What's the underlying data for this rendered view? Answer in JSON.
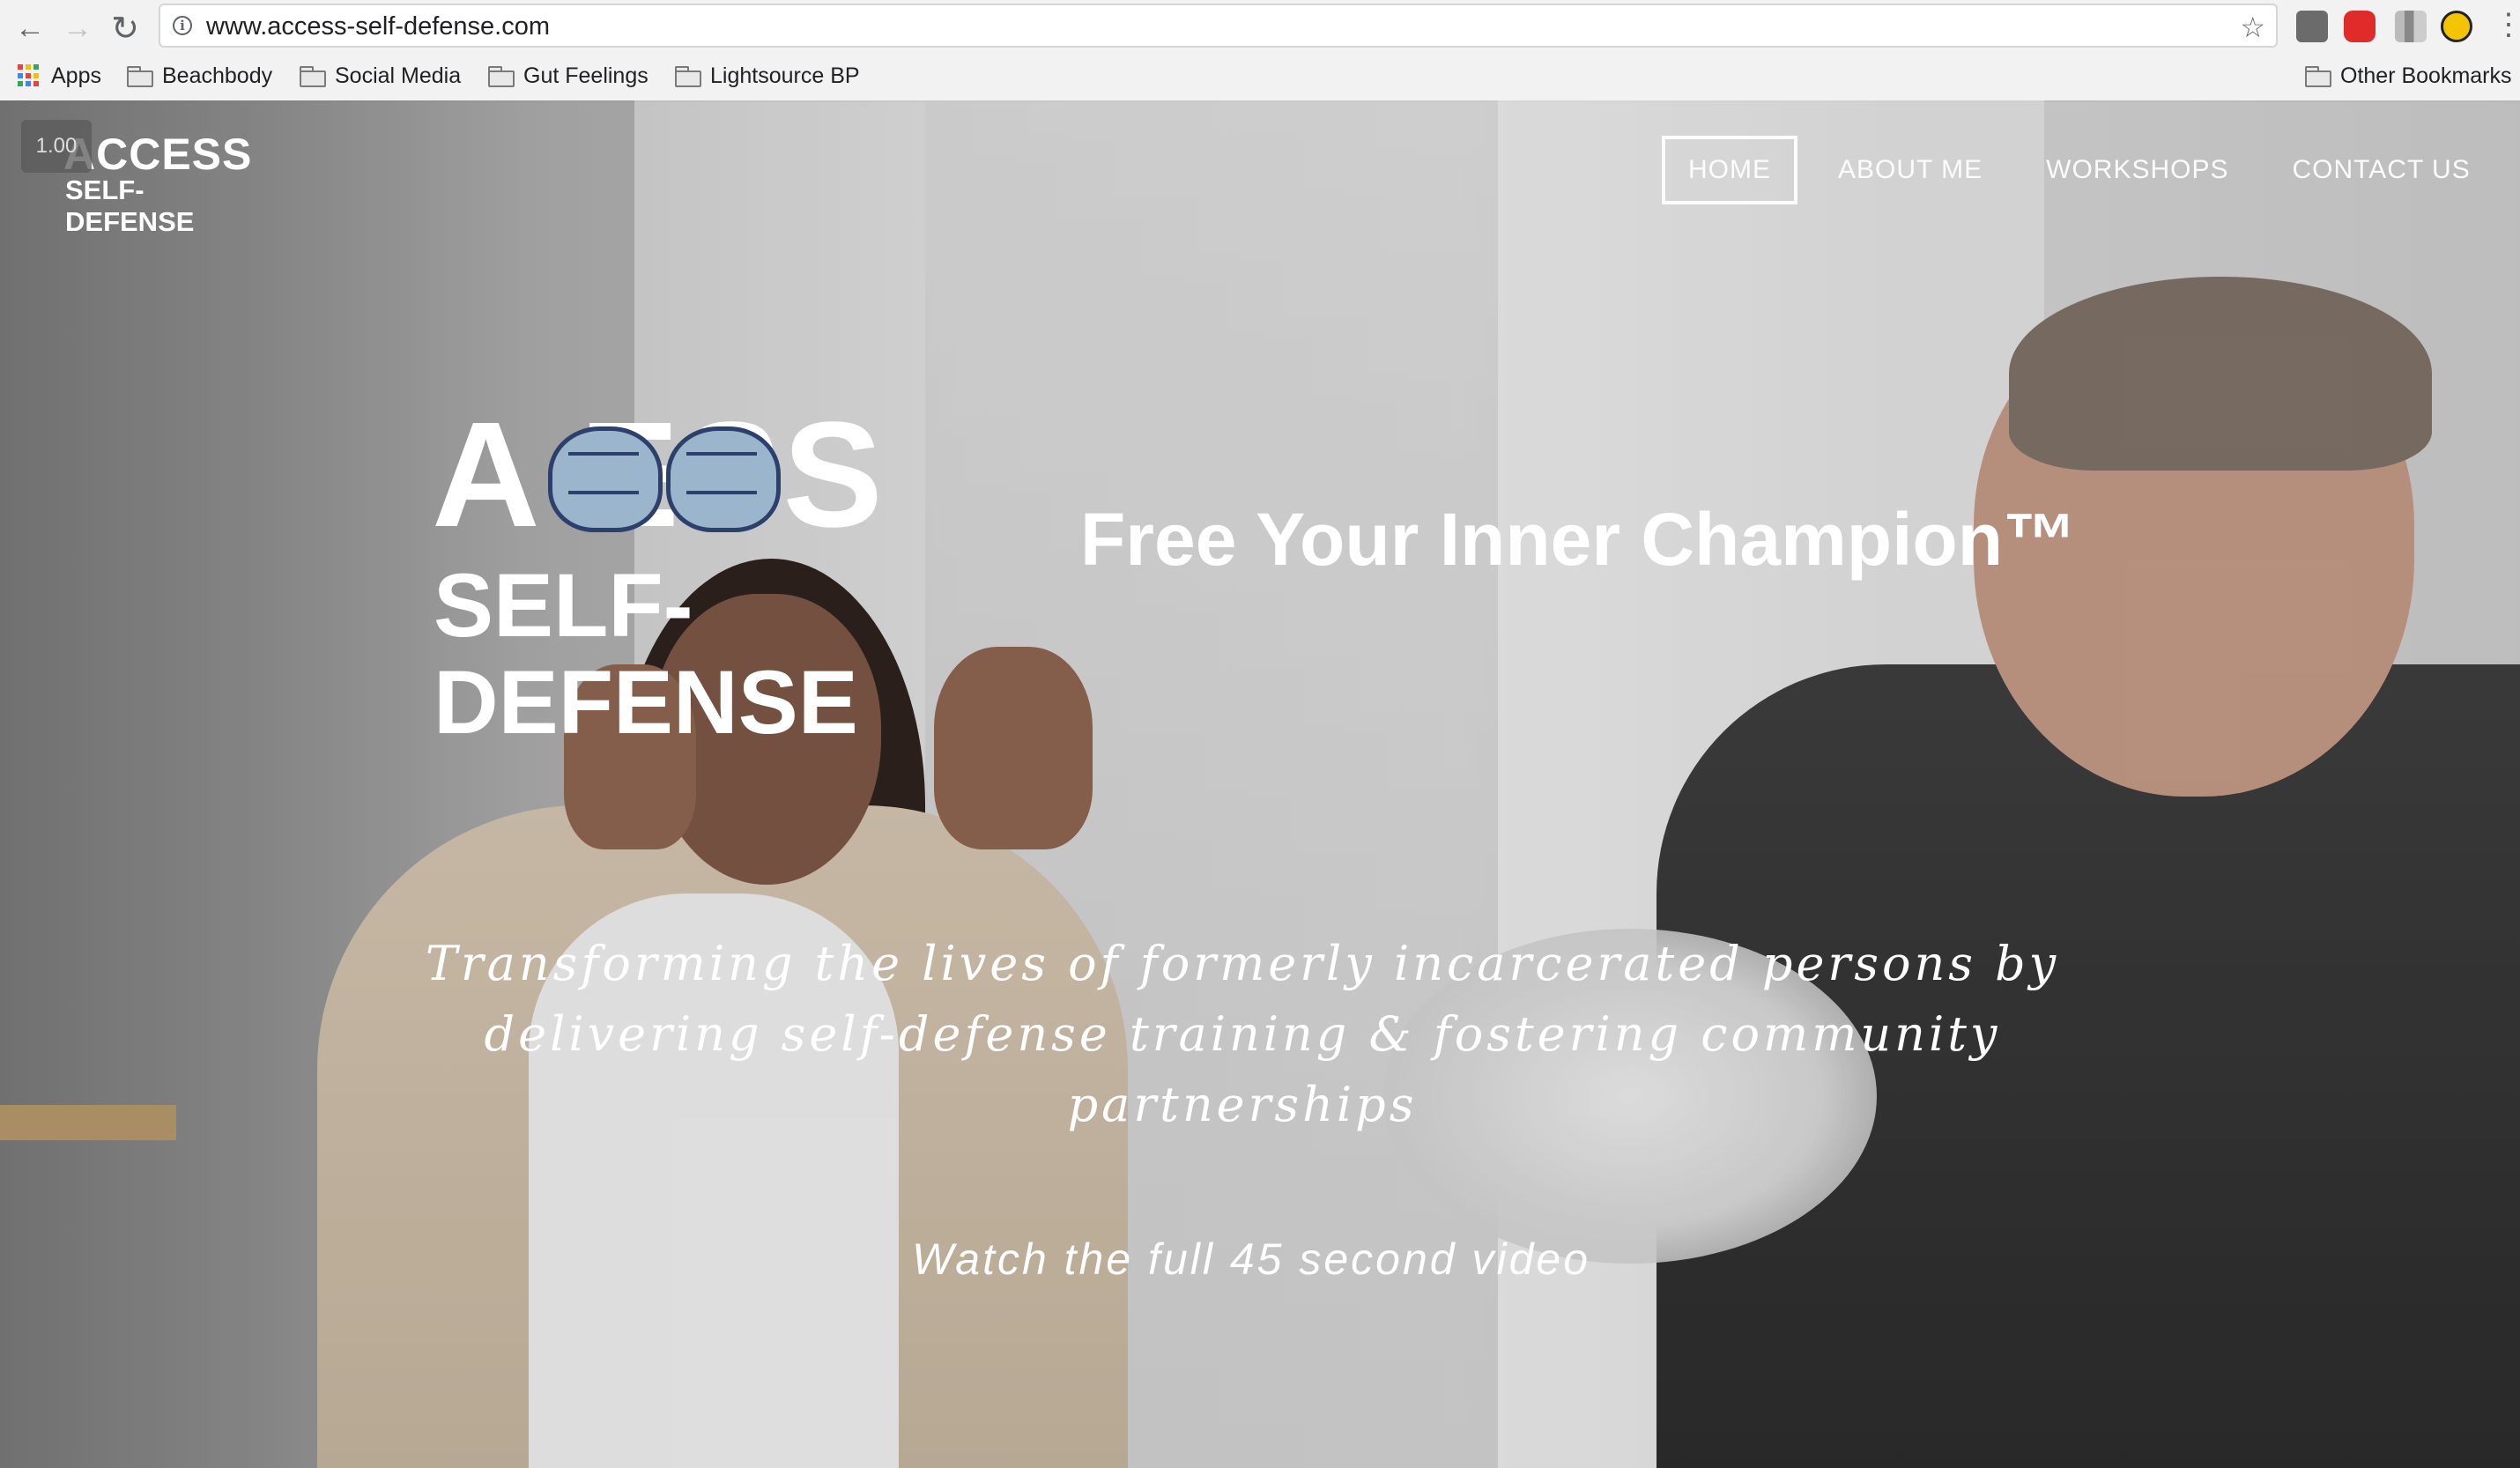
{
  "browser": {
    "url": "www.access-self-defense.com",
    "bookmarks": [
      "Apps",
      "Beachbody",
      "Social Media",
      "Gut Feelings",
      "Lightsource BP"
    ],
    "other_bookmarks": "Other Bookmarks"
  },
  "site": {
    "zoom_badge": "1.00",
    "logo_line1": "ACCESS",
    "logo_line2": "SELF-DEFENSE",
    "nav": [
      "HOME",
      "ABOUT ME",
      "WORKSHOPS",
      "CONTACT US"
    ],
    "hero_logo_line1": "A    ESS",
    "hero_logo_line2": "SELF-DEFENSE",
    "tagline": "Free Your Inner Champion™",
    "mission": "Transforming the lives of formerly incarcerated persons by delivering self-defense training & fostering community partnerships",
    "watch_link": "Watch the full 45 second video"
  },
  "colors": {
    "fist_fill": "#9bb6cc",
    "fist_outline": "#2d3f6b"
  },
  "icons": [
    "back-arrow-icon",
    "forward-arrow-icon",
    "reload-icon",
    "info-icon",
    "bookmark-star-icon",
    "apps-grid-icon",
    "folder-icon",
    "menu-dots-icon"
  ]
}
